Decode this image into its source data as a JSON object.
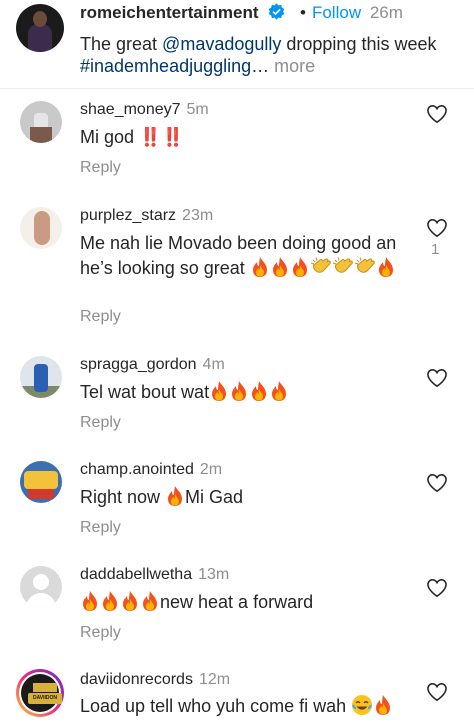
{
  "post": {
    "username": "romeichentertainment",
    "separator": "•",
    "follow_label": "Follow",
    "time": "26m",
    "caption_pre": "The great ",
    "caption_mention": "@mavadogully",
    "caption_mid": " dropping this week ",
    "caption_hashtag": "#inademheadjuggling",
    "caption_ellipsis": "…",
    "more_label": "more",
    "verified_color": "#0095f6"
  },
  "comments": [
    {
      "username": "shae_money7",
      "time": "5m",
      "text": "Mi god ",
      "emoji_text": "‼️‼️",
      "reply_label": "Reply"
    },
    {
      "username": "purplez_starz",
      "time": "23m",
      "text": "Me nah lie Movado been doing good an he’s looking so great ",
      "emojis": "🔥🔥🔥👏👏👏🔥",
      "likes": "1",
      "reply_label": "Reply"
    },
    {
      "username": "spragga_gordon",
      "time": "4m",
      "text": "Tel wat bout wat",
      "emojis": "🔥🔥🔥🔥",
      "reply_label": "Reply"
    },
    {
      "username": "champ.anointed",
      "time": "2m",
      "text_pre": "Right now ",
      "emoji": "🔥",
      "text_post": "Mi Gad",
      "reply_label": "Reply"
    },
    {
      "username": "daddabellwetha",
      "time": "13m",
      "emojis": "🔥🔥🔥🔥",
      "text": "new heat a forward",
      "reply_label": "Reply"
    },
    {
      "username": "daviidonrecords",
      "time": "12m",
      "text": "Load up tell who yuh come fi wah ",
      "emojis": "😂🔥",
      "avatar_text": "DAVIIDON RECORDS"
    }
  ],
  "colors": {
    "accent": "#0095f6",
    "link": "#00376b",
    "muted": "#8e8e8e",
    "fire": "#f25a1d",
    "bang": "#e0191b"
  }
}
